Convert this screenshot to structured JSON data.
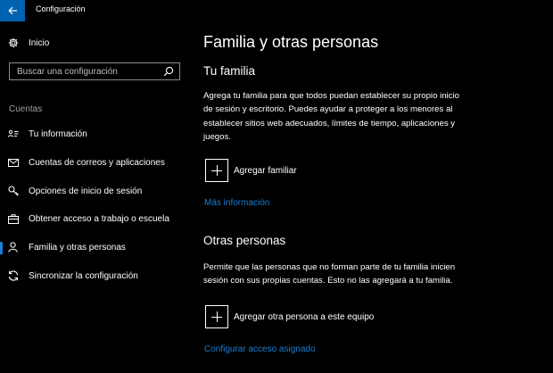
{
  "window": {
    "title": "Configuración"
  },
  "sidebar": {
    "home_label": "Inicio",
    "search_placeholder": "Buscar una configuración",
    "section_label": "Cuentas",
    "items": [
      {
        "label": "Tu información",
        "icon": "person-card-icon"
      },
      {
        "label": "Cuentas de correos y aplicaciones",
        "icon": "mail-icon"
      },
      {
        "label": "Opciones de inicio de sesión",
        "icon": "key-icon"
      },
      {
        "label": "Obtener acceso a trabajo o escuela",
        "icon": "briefcase-icon"
      },
      {
        "label": "Familia y otras personas",
        "icon": "person-icon",
        "selected": true
      },
      {
        "label": "Sincronizar la configuración",
        "icon": "sync-icon"
      }
    ]
  },
  "main": {
    "title": "Familia y otras personas",
    "family": {
      "heading": "Tu familia",
      "description": "Agrega tu familia para que todos puedan establecer su propio inicio de sesión y escritorio. Puedes ayudar a proteger a los menores al establecer sitios web adecuados, límites de tiempo, aplicaciones y juegos.",
      "add_label": "Agregar familiar",
      "more_info_link": "Más información"
    },
    "others": {
      "heading": "Otras personas",
      "description": "Permite que las personas que no forman parte de tu familia inicien sesión con sus propias cuentas. Esto no las agregará a tu familia.",
      "add_label": "Agregar otra persona a este equipo",
      "assigned_access_link": "Configurar acceso asignado"
    }
  },
  "colors": {
    "accent": "#0063b1",
    "link": "#1a7fd4",
    "background": "#000000"
  }
}
